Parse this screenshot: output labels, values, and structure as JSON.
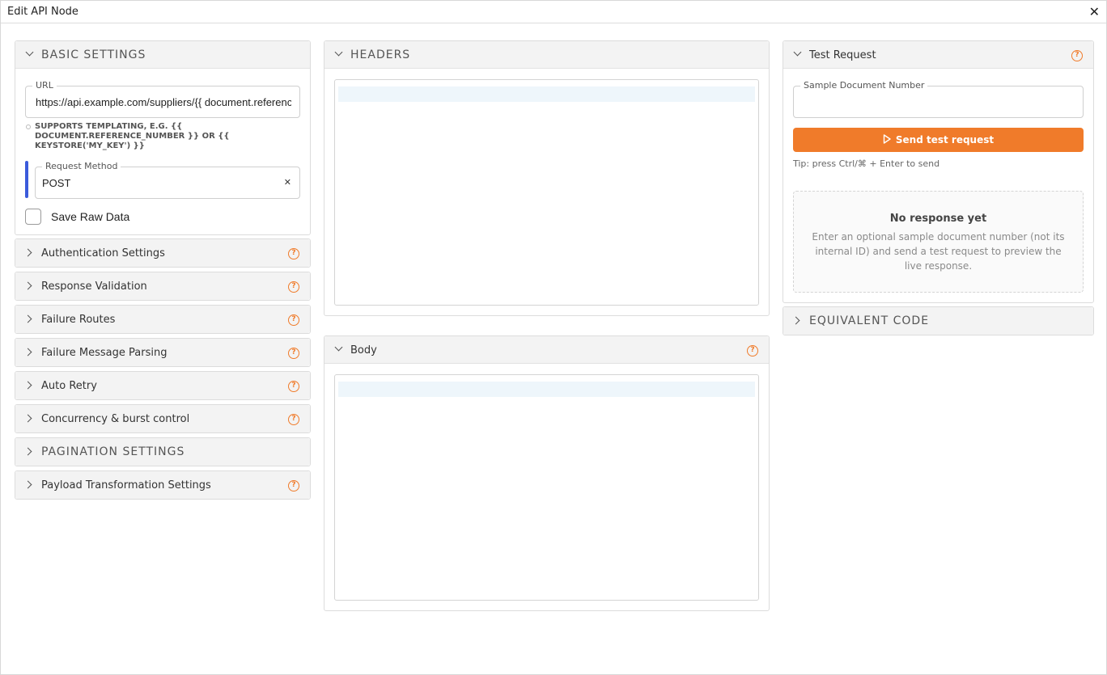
{
  "window": {
    "title": "Edit API Node",
    "close_glyph": "✕"
  },
  "basic_settings": {
    "title": "BASIC SETTINGS",
    "url": {
      "label": "URL",
      "value": "https://api.example.com/suppliers/{{ document.reference_number }}"
    },
    "url_hint": "SUPPORTS TEMPLATING, E.G. {{ DOCUMENT.REFERENCE_NUMBER }} OR {{ KEYSTORE('MY_KEY') }}",
    "request_method": {
      "label": "Request Method",
      "value": "POST",
      "clear_glyph": "✕"
    },
    "save_raw_data": {
      "label": "Save Raw Data",
      "checked": false
    }
  },
  "sections": [
    {
      "label": "Authentication Settings",
      "help": true
    },
    {
      "label": "Response Validation",
      "help": true
    },
    {
      "label": "Failure Routes",
      "help": true
    },
    {
      "label": "Failure Message Parsing",
      "help": true
    },
    {
      "label": "Auto Retry",
      "help": true
    },
    {
      "label": "Concurrency & burst control",
      "help": true
    },
    {
      "label": "PAGINATION SETTINGS",
      "help": false
    },
    {
      "label": "Payload Transformation Settings",
      "help": true
    }
  ],
  "headers_panel": {
    "title": "HEADERS"
  },
  "body_panel": {
    "title": "Body"
  },
  "test_request": {
    "title": "Test Request",
    "sample_label": "Sample Document Number",
    "sample_value": "",
    "send_label": "Send test request",
    "tip": "Tip: press Ctrl/⌘ + Enter to send",
    "empty_title": "No response yet",
    "empty_text": "Enter an optional sample document number (not its internal ID) and send a test request to preview the live response."
  },
  "equivalent_code": {
    "title": "EQUIVALENT CODE"
  },
  "colors": {
    "accent": "#f07b2a",
    "focus_bar": "#3b5bdb"
  },
  "help_glyph": "?"
}
